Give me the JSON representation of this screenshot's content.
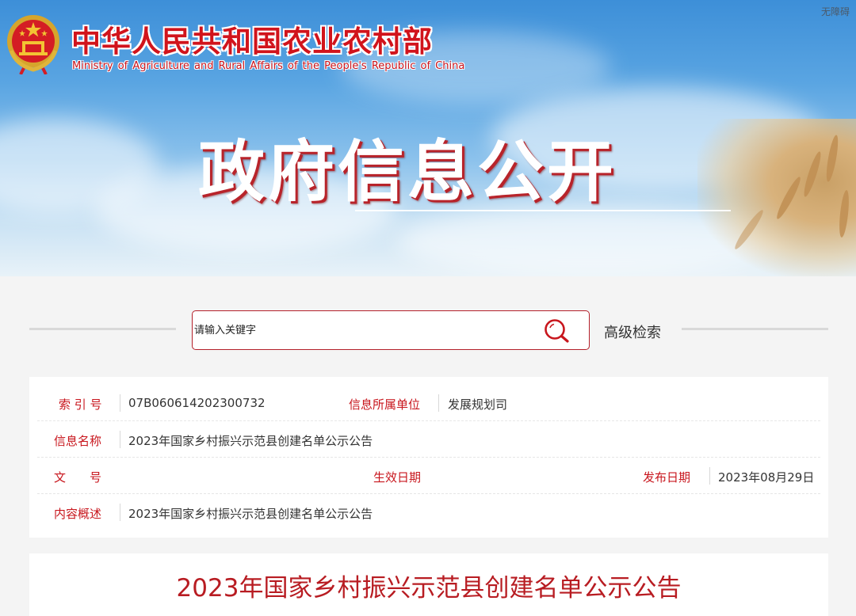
{
  "header": {
    "ministry_cn": "中华人民共和国农业农村部",
    "ministry_en": "Ministry of Agriculture and Rural Affairs of the People's Republic of China",
    "accessibility": "无障碍",
    "hero_title": "政府信息公开",
    "emblem_icon": "national-emblem-icon"
  },
  "search": {
    "placeholder": "请输入关键字",
    "button_icon": "search-icon",
    "advanced_label": "高级检索"
  },
  "info": {
    "index_label": "索 引 号",
    "index_value": "07B060614202300732",
    "unit_label": "信息所属单位",
    "unit_value": "发展规划司",
    "name_label": "信息名称",
    "name_value": "2023年国家乡村振兴示范县创建名单公示公告",
    "doc_label": "文　　号",
    "effective_label": "生效日期",
    "publish_label": "发布日期",
    "publish_value": "2023年08月29日",
    "summary_label": "内容概述",
    "summary_value": "2023年国家乡村振兴示范县创建名单公示公告"
  },
  "article": {
    "title": "2023年国家乡村振兴示范县创建名单公示公告"
  },
  "colors": {
    "accent_red": "#c8161d",
    "banner_sky": "#5aa5e2"
  }
}
